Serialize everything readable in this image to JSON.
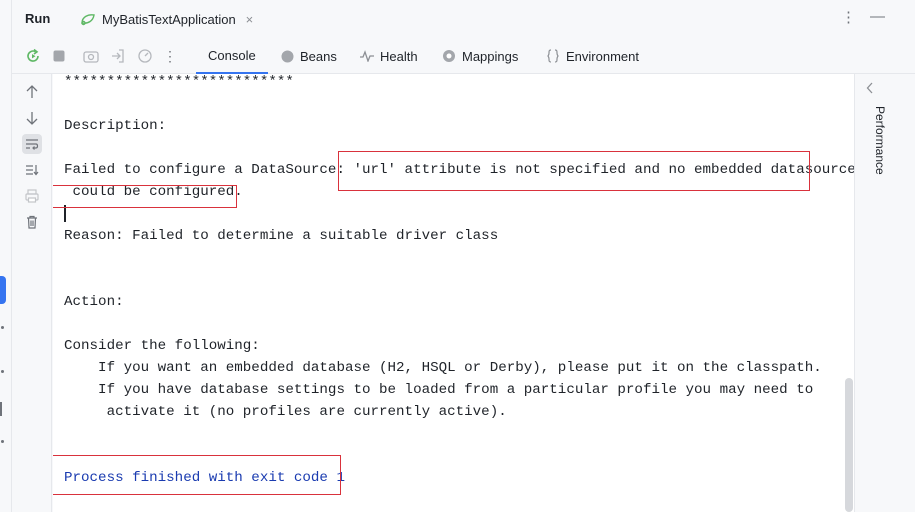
{
  "window": {
    "run_label": "Run",
    "tab_title": "MyBatisTextApplication",
    "tab_close": "×",
    "more_actions": "⋮",
    "minimize": "—"
  },
  "toolbar": {
    "tabs": [
      {
        "label": "Console",
        "selected": true
      },
      {
        "label": "Beans",
        "selected": false
      },
      {
        "label": "Health",
        "selected": false
      },
      {
        "label": "Mappings",
        "selected": false
      },
      {
        "label": "Environment",
        "selected": false
      }
    ],
    "more": "⋮"
  },
  "right_panel": {
    "label": "Performance"
  },
  "console": {
    "lines": [
      "***************************",
      "",
      "Description:",
      "",
      "Failed to configure a DataSource: 'url' attribute is not specified and no embedded datasource",
      " could be configured.",
      "",
      "Reason: Failed to determine a suitable driver class",
      "",
      "",
      "Action:",
      "",
      "Consider the following:",
      "    If you want an embedded database (H2, HSQL or Derby), please put it on the classpath.",
      "    If you have database settings to be loaded from a particular profile you may need to",
      "     activate it (no profiles are currently active).",
      "",
      "",
      "Process finished with exit code 1"
    ]
  },
  "colors": {
    "accent": "#3574f0",
    "highlight_box": "#d9323c",
    "exit_text": "#1a3bb0"
  }
}
